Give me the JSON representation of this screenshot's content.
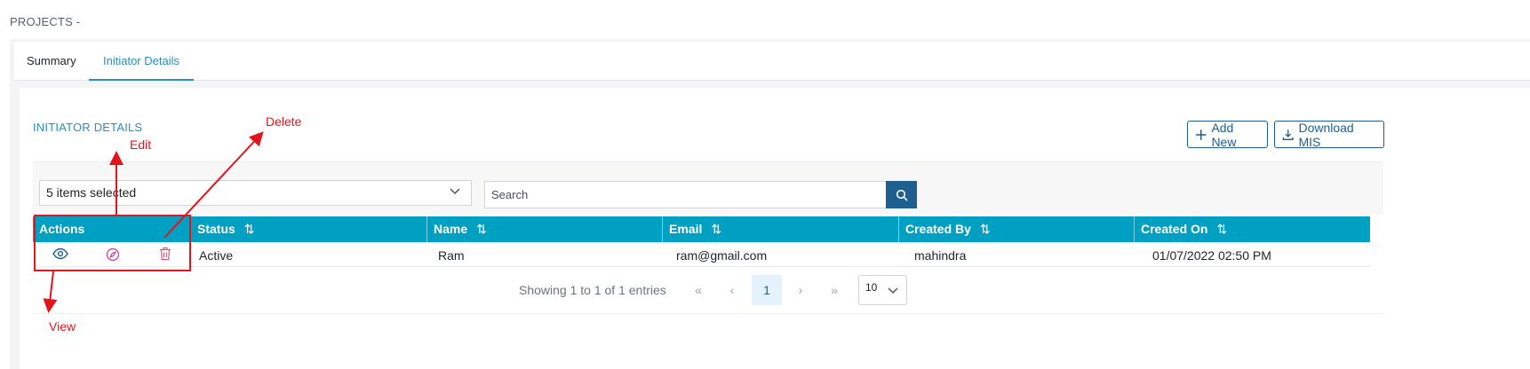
{
  "page": {
    "title": "PROJECTS -"
  },
  "tabs": [
    {
      "label": "Summary"
    },
    {
      "label": "Initiator Details"
    }
  ],
  "section": {
    "title": "INITIATOR DETAILS"
  },
  "toolbar": {
    "add_label": "Add New",
    "download_label": "Download MIS"
  },
  "filter": {
    "columns_selected": "5 items selected",
    "search_placeholder": "Search"
  },
  "table": {
    "columns": [
      "Actions",
      "Status",
      "Name",
      "Email",
      "Created By",
      "Created On"
    ],
    "rows": [
      {
        "status": "Active",
        "name": "Ram",
        "email": "ram@gmail.com",
        "created_by": "mahindra",
        "created_on": "01/07/2022 02:50 PM"
      }
    ]
  },
  "pagination": {
    "info": "Showing 1 to 1 of 1 entries",
    "first": "«",
    "prev": "‹",
    "current": "1",
    "next": "›",
    "last": "»",
    "per_page": "10"
  },
  "annotations": {
    "view": "View",
    "edit": "Edit",
    "delete": "Delete"
  },
  "colors": {
    "accent": "#00a0c2",
    "primary": "#1d5f8f",
    "annotation": "#e3141b",
    "edit_icon": "#d63384",
    "delete_icon": "#e05a7a",
    "view_icon": "#1d5f8f"
  },
  "icons": {
    "view": "eye-icon",
    "edit": "compass-edit-icon",
    "delete": "trash-icon",
    "search": "search-icon",
    "add": "plus-icon",
    "download": "download-icon",
    "sort": "sort-icon"
  }
}
